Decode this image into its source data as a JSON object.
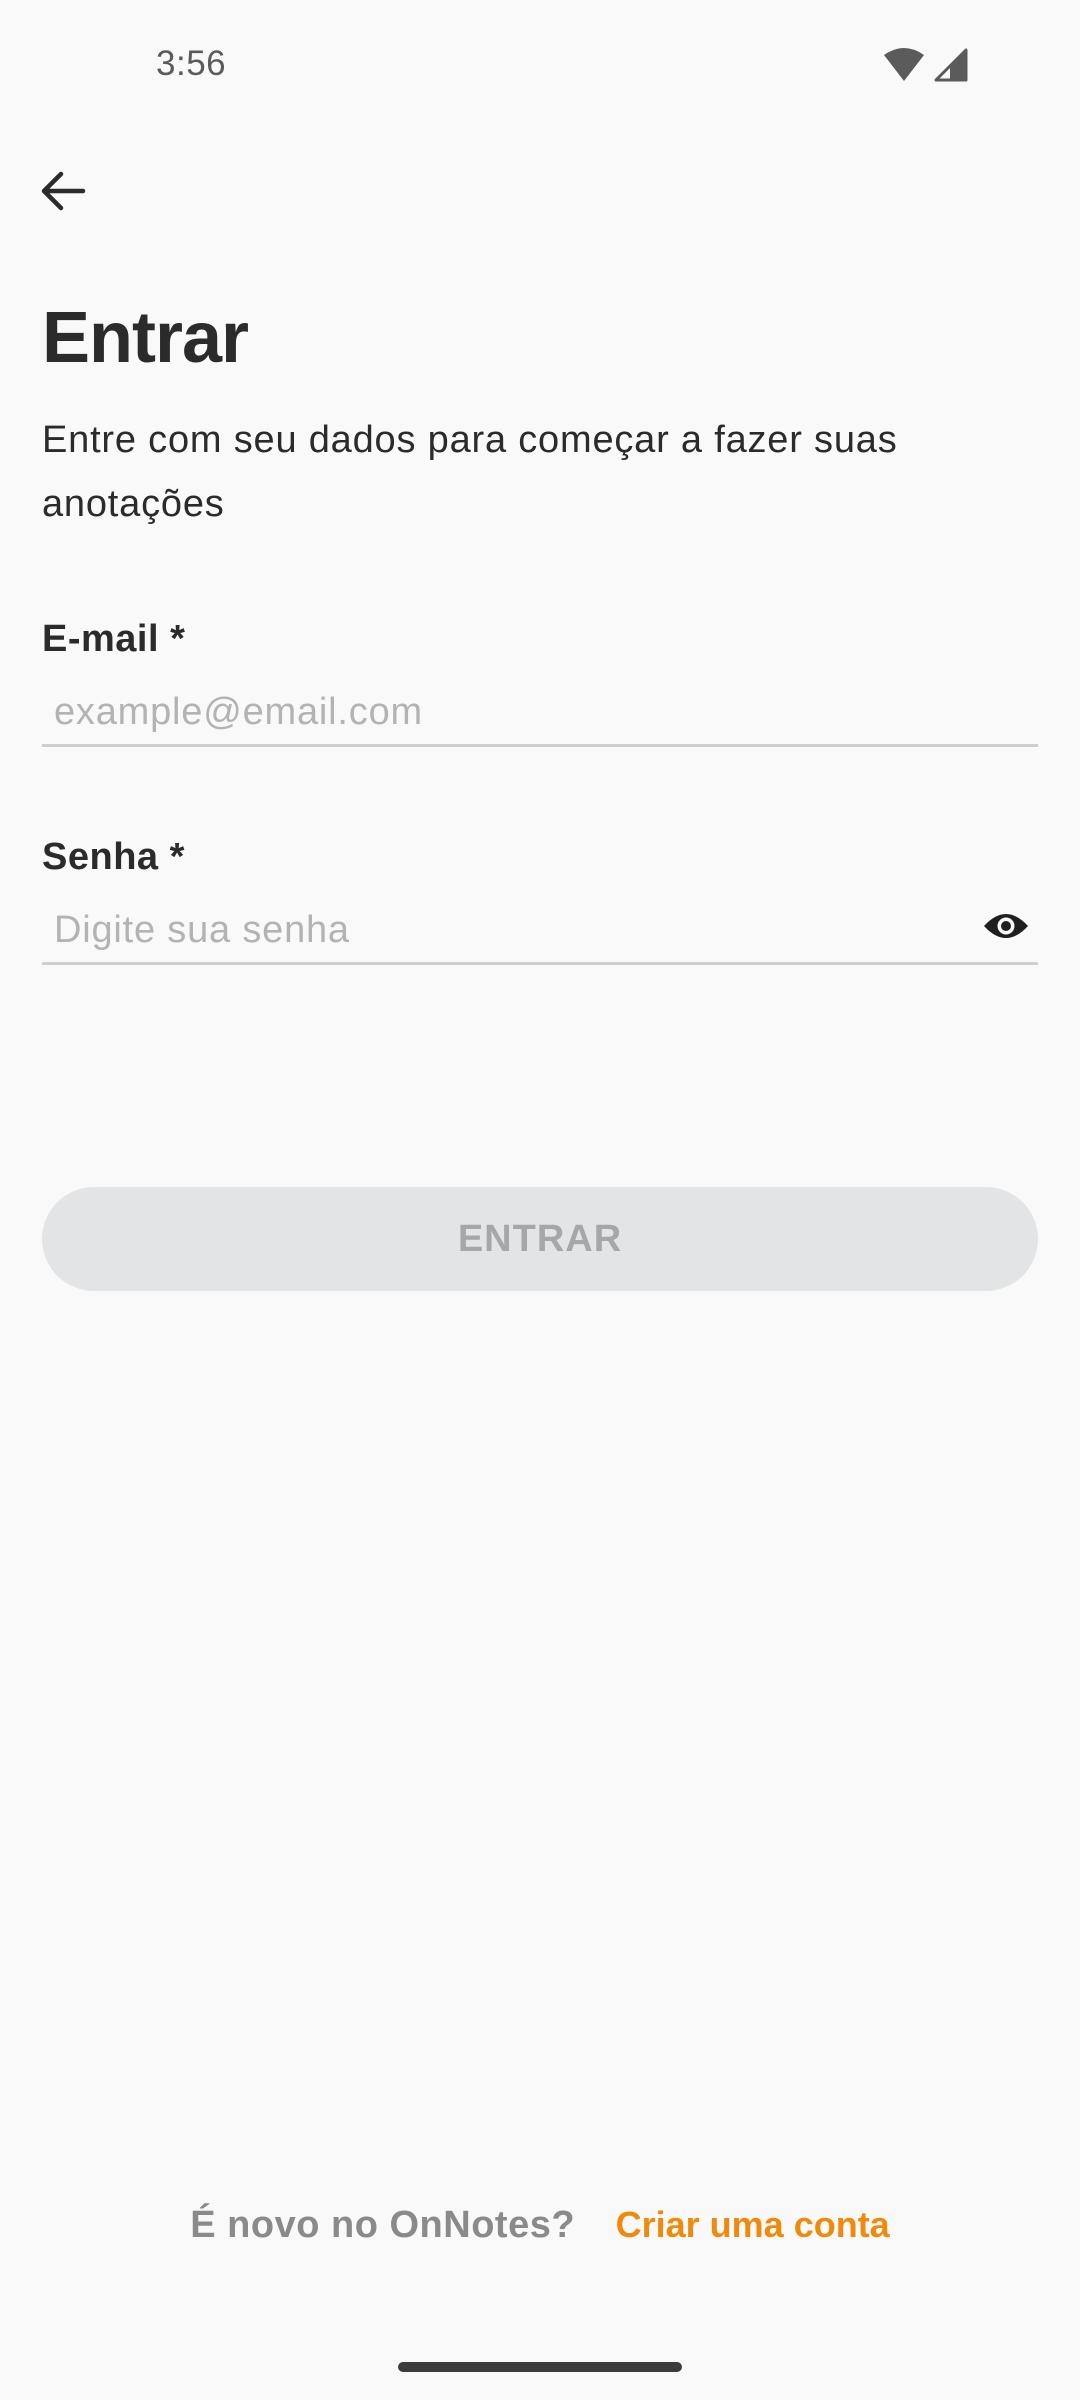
{
  "status_bar": {
    "time": "3:56"
  },
  "header": {
    "back_icon": "arrow-left-icon"
  },
  "page": {
    "title": "Entrar",
    "subtitle": "Entre com seu dados para começar a fazer suas anotações"
  },
  "form": {
    "email": {
      "label": "E-mail *",
      "value": "",
      "placeholder": "example@email.com"
    },
    "password": {
      "label": "Senha *",
      "value": "",
      "placeholder": "Digite sua senha",
      "toggle_icon": "eye-icon"
    },
    "submit_label": "ENTRAR"
  },
  "footer": {
    "prompt": "É novo no OnNotes?",
    "signup_link": "Criar uma conta"
  },
  "colors": {
    "background": "#f9f9f9",
    "text": "#2b2b2b",
    "accent": "#f08a0c",
    "button_disabled_bg": "#e3e4e5",
    "button_disabled_text": "#a5a7a9",
    "placeholder": "#b3b3b3"
  }
}
